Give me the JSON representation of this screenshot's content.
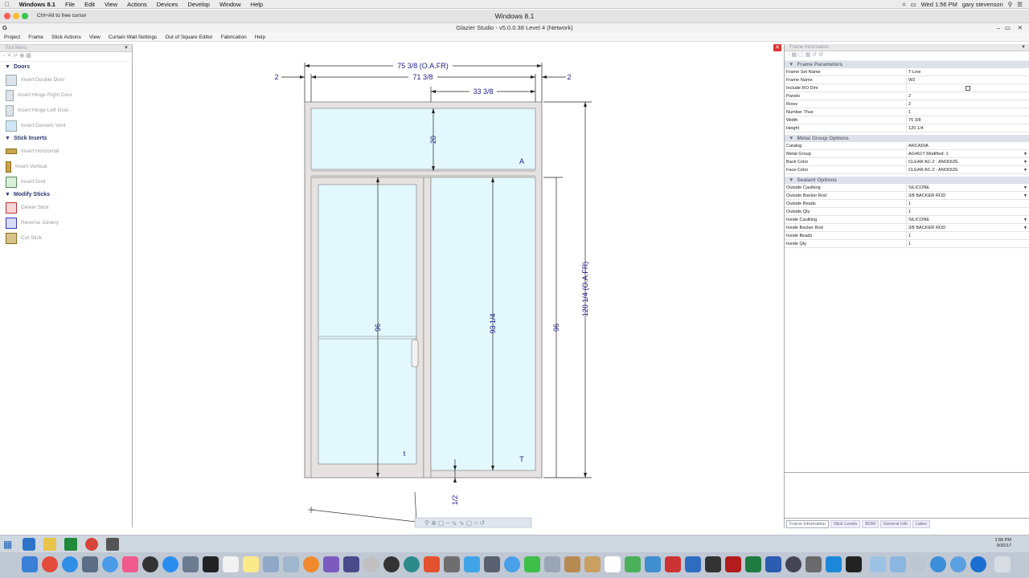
{
  "mac_menubar": {
    "items": [
      "Windows 8.1",
      "File",
      "Edit",
      "View",
      "Actions",
      "Devices",
      "Develop",
      "Window",
      "Help"
    ],
    "clock": "Wed 1:56 PM",
    "user": "gary stevenson"
  },
  "vm_toolbar": {
    "hint": "Ctrl+Alt to free cursor",
    "title": "Windows 8.1"
  },
  "app": {
    "title": "Glazier Studio - v5.0.0.38 Level 4 (Network)",
    "menu": [
      "Project",
      "Frame",
      "Stick Actions",
      "View",
      "Curtain Wall Settings",
      "Out of Square Editor",
      "Fabrication",
      "Help"
    ]
  },
  "tool_menu": {
    "header": "Tool Menu",
    "groups": [
      {
        "label": "Doors",
        "items": [
          "Insert Double Door",
          "Insert Hinge Right Door",
          "Insert Hinge Left Door",
          "Insert Generic Vent"
        ]
      },
      {
        "label": "Stick Inserts",
        "items": [
          "Insert Horizontal",
          "Insert Vertical",
          "Insert Grid"
        ]
      },
      {
        "label": "Modify Sticks",
        "items": [
          "Delete Stick",
          "Reverse Joinery",
          "Cut Stick"
        ]
      }
    ]
  },
  "drawing": {
    "overall_width": "75 3/8 (O.A.FR)",
    "inner_width": "71 3/8",
    "right_width": "33 3/8",
    "left_offset": "2",
    "right_offset": "2",
    "transom_height": "20",
    "door_height": "96",
    "sidelite_height": "93 1/4",
    "right_height": "96",
    "overall_height": "120 1/4 (O.A.FR)",
    "bottom_dim": "1/2",
    "mark_a": "A",
    "mark_t_small": "t",
    "mark_t": "T"
  },
  "frame_information": {
    "header": "Frame Information",
    "sections": [
      {
        "label": "Frame Parameters",
        "rows": [
          {
            "k": "Frame Set Name",
            "v": "T-Line"
          },
          {
            "k": "Frame Name",
            "v": "W2"
          },
          {
            "k": "Include RO Dim",
            "v": ""
          },
          {
            "k": "Panels",
            "v": "2"
          },
          {
            "k": "Rows",
            "v": "2"
          },
          {
            "k": "Number Thus",
            "v": "1"
          },
          {
            "k": "Width",
            "v": "75 3/8"
          },
          {
            "k": "Height",
            "v": "120 1/4"
          }
        ]
      },
      {
        "label": "Metal Group Options",
        "rows": [
          {
            "k": "Catalog",
            "v": "ARCADIA"
          },
          {
            "k": "Metal Group",
            "v": "AG451T Modified: 1"
          },
          {
            "k": "Back Color",
            "v": "CLEAR AC-2 : ANODIZE"
          },
          {
            "k": "Face Color",
            "v": "CLEAR AC-2 : ANODIZE"
          }
        ]
      },
      {
        "label": "Sealant Options",
        "rows": [
          {
            "k": "Outside Caulking",
            "v": "SILICONE"
          },
          {
            "k": "Outside Backer Rod",
            "v": "3/8 BACKER ROD"
          },
          {
            "k": "Outside Beads",
            "v": "1"
          },
          {
            "k": "Outside Qty",
            "v": "1"
          },
          {
            "k": "Inside Caulking",
            "v": "SILICONE"
          },
          {
            "k": "Inside Backer Rod",
            "v": "3/8 BACKER ROD"
          },
          {
            "k": "Inside Beads",
            "v": "1"
          },
          {
            "k": "Inside Qty",
            "v": "1"
          }
        ]
      }
    ],
    "tabs": [
      "Frame Information",
      "Stick Levels",
      "BOM",
      "General Info",
      "Labor"
    ]
  },
  "taskbar": {
    "time": "1:56 PM",
    "date": "9/20/17"
  },
  "colors": {
    "glass": "#e3f8fc",
    "frame": "#e6e2e2",
    "dimension": "#1a1a8c",
    "accent": "#2b3a70"
  }
}
